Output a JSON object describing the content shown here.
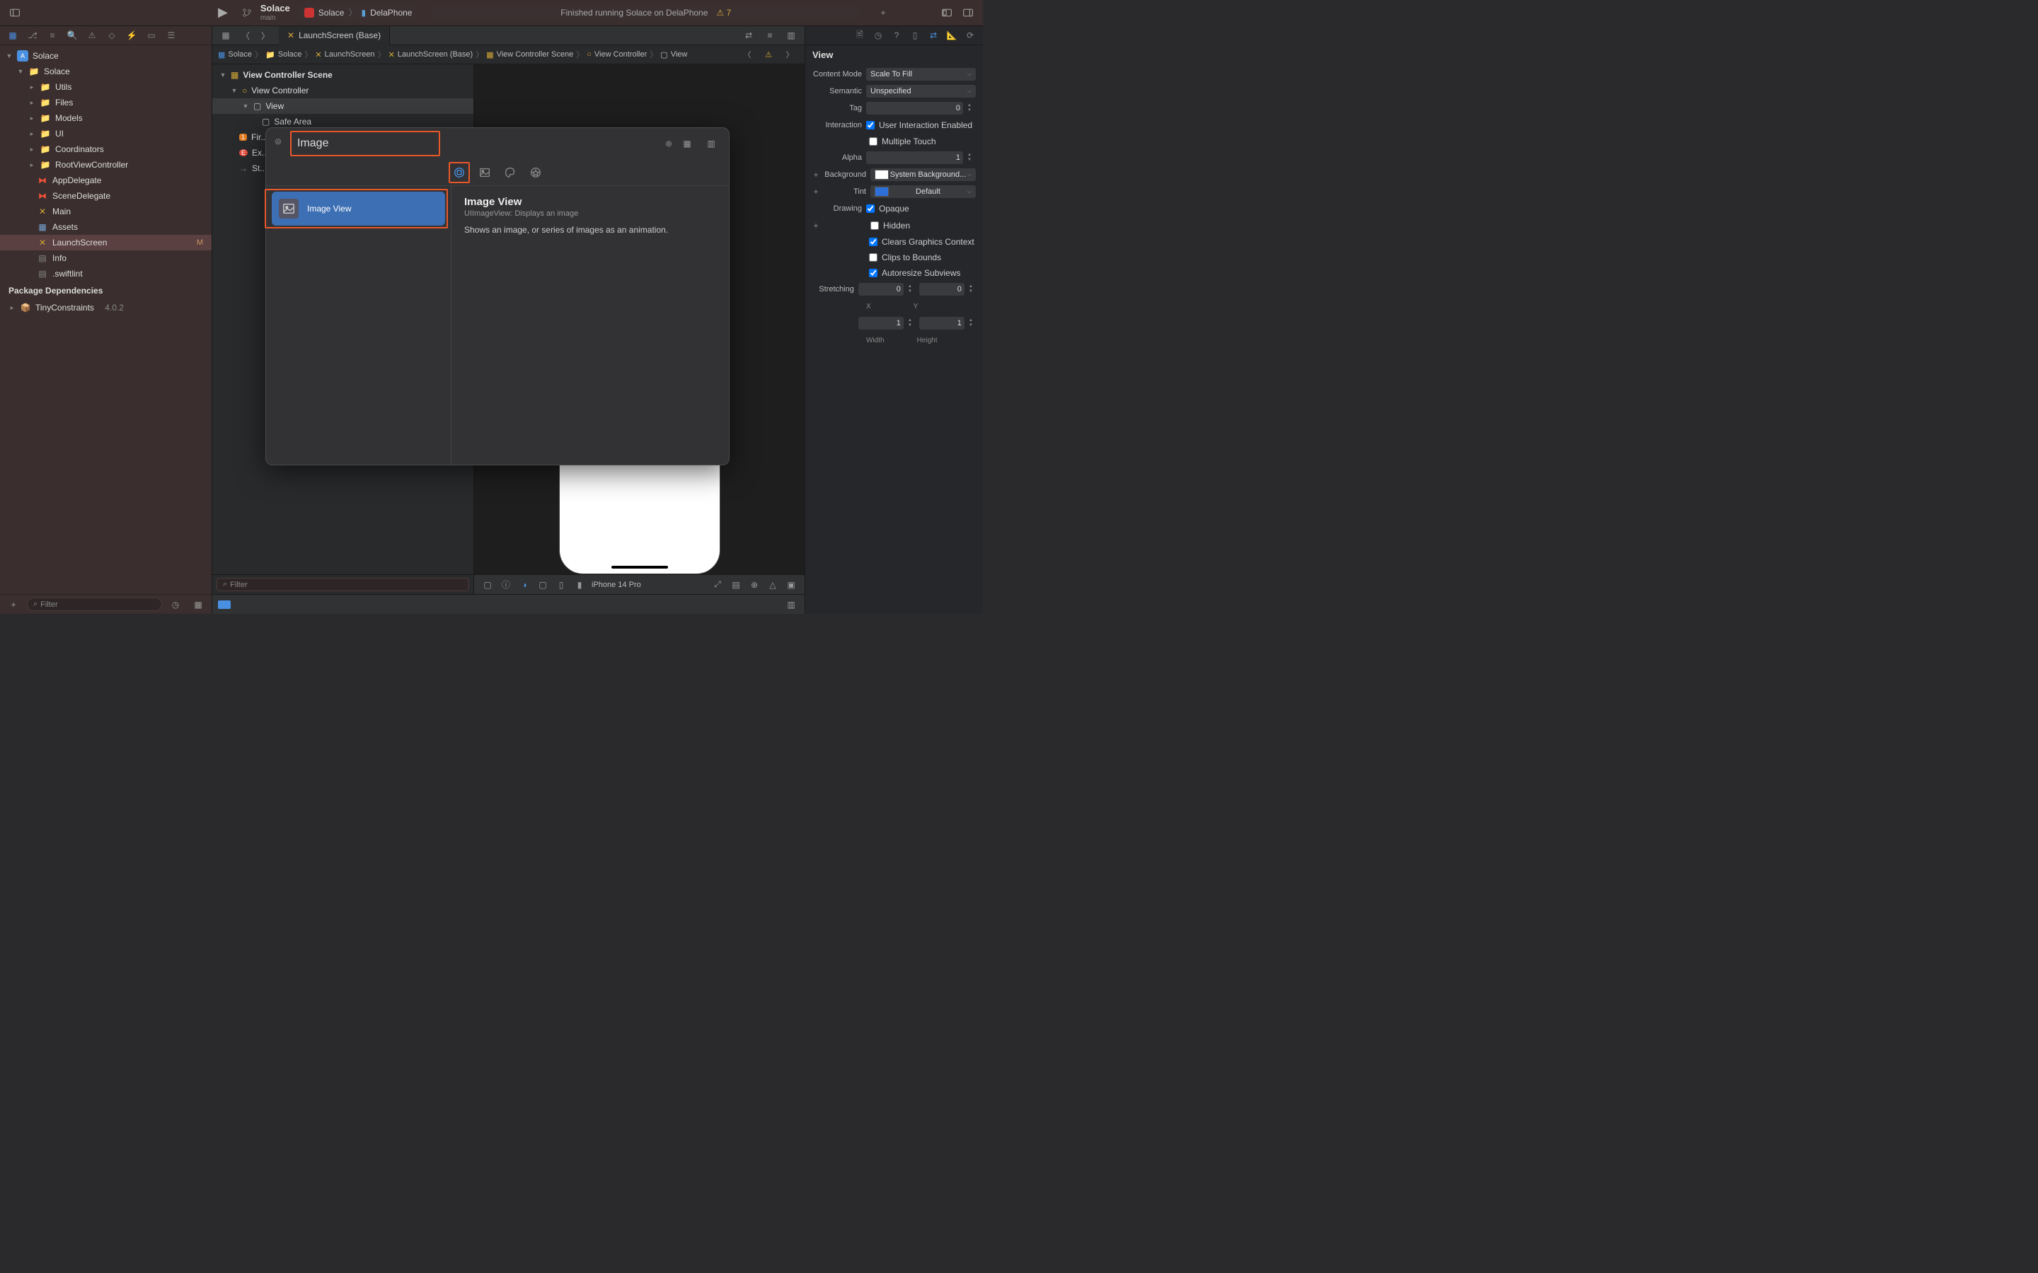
{
  "project": {
    "name": "Solace",
    "branch": "main"
  },
  "scheme": {
    "target": "Solace",
    "device": "DelaPhone"
  },
  "status": {
    "text": "Finished running Solace on DelaPhone",
    "warnings": "7"
  },
  "navigator": {
    "root": "Solace",
    "group": "Solace",
    "folders": [
      "Utils",
      "Files",
      "Models",
      "UI",
      "Coordinators",
      "RootViewController"
    ],
    "files": [
      {
        "name": "AppDelegate",
        "type": "swift"
      },
      {
        "name": "SceneDelegate",
        "type": "swift"
      },
      {
        "name": "Main",
        "type": "ib"
      },
      {
        "name": "Assets",
        "type": "assets"
      },
      {
        "name": "LaunchScreen",
        "type": "ib",
        "badge": "M",
        "selected": true
      },
      {
        "name": "Info",
        "type": "plist"
      },
      {
        "name": ".swiftlint",
        "type": "file"
      }
    ],
    "packages_header": "Package Dependencies",
    "packages": [
      {
        "name": "TinyConstraints",
        "version": "4.0.2"
      }
    ],
    "filter_placeholder": "Filter"
  },
  "tabs": {
    "active": "LaunchScreen (Base)"
  },
  "breadcrumb": [
    "Solace",
    "Solace",
    "LaunchScreen",
    "LaunchScreen (Base)",
    "View Controller Scene",
    "View Controller",
    "View"
  ],
  "outline": {
    "scene": "View Controller Scene",
    "vc": "View Controller",
    "view": "View",
    "safe_area": "Safe Area",
    "exits": [
      "Fir...",
      "Ex...",
      "St..."
    ],
    "filter_placeholder": "Filter"
  },
  "canvas": {
    "device": "iPhone 14 Pro"
  },
  "library": {
    "search": "Image",
    "item_name": "Image View",
    "detail": {
      "title": "Image View",
      "subtitle": "UIImageView: Displays an image",
      "description": "Shows an image, or series of images as an animation."
    }
  },
  "inspector": {
    "title": "View",
    "content_mode_label": "Content Mode",
    "content_mode": "Scale To Fill",
    "semantic_label": "Semantic",
    "semantic": "Unspecified",
    "tag_label": "Tag",
    "tag": "0",
    "interaction_label": "Interaction",
    "user_interaction": "User Interaction Enabled",
    "multiple_touch": "Multiple Touch",
    "alpha_label": "Alpha",
    "alpha": "1",
    "background_label": "Background",
    "background": "System Background...",
    "tint_label": "Tint",
    "tint": "Default",
    "drawing_label": "Drawing",
    "opaque": "Opaque",
    "hidden": "Hidden",
    "clears_graphics": "Clears Graphics Context",
    "clips_bounds": "Clips to Bounds",
    "autoresize": "Autoresize Subviews",
    "stretching_label": "Stretching",
    "stretch_x": "0",
    "stretch_y": "0",
    "stretch_w": "1",
    "stretch_h": "1",
    "x_label": "X",
    "y_label": "Y",
    "w_label": "Width",
    "h_label": "Height"
  }
}
